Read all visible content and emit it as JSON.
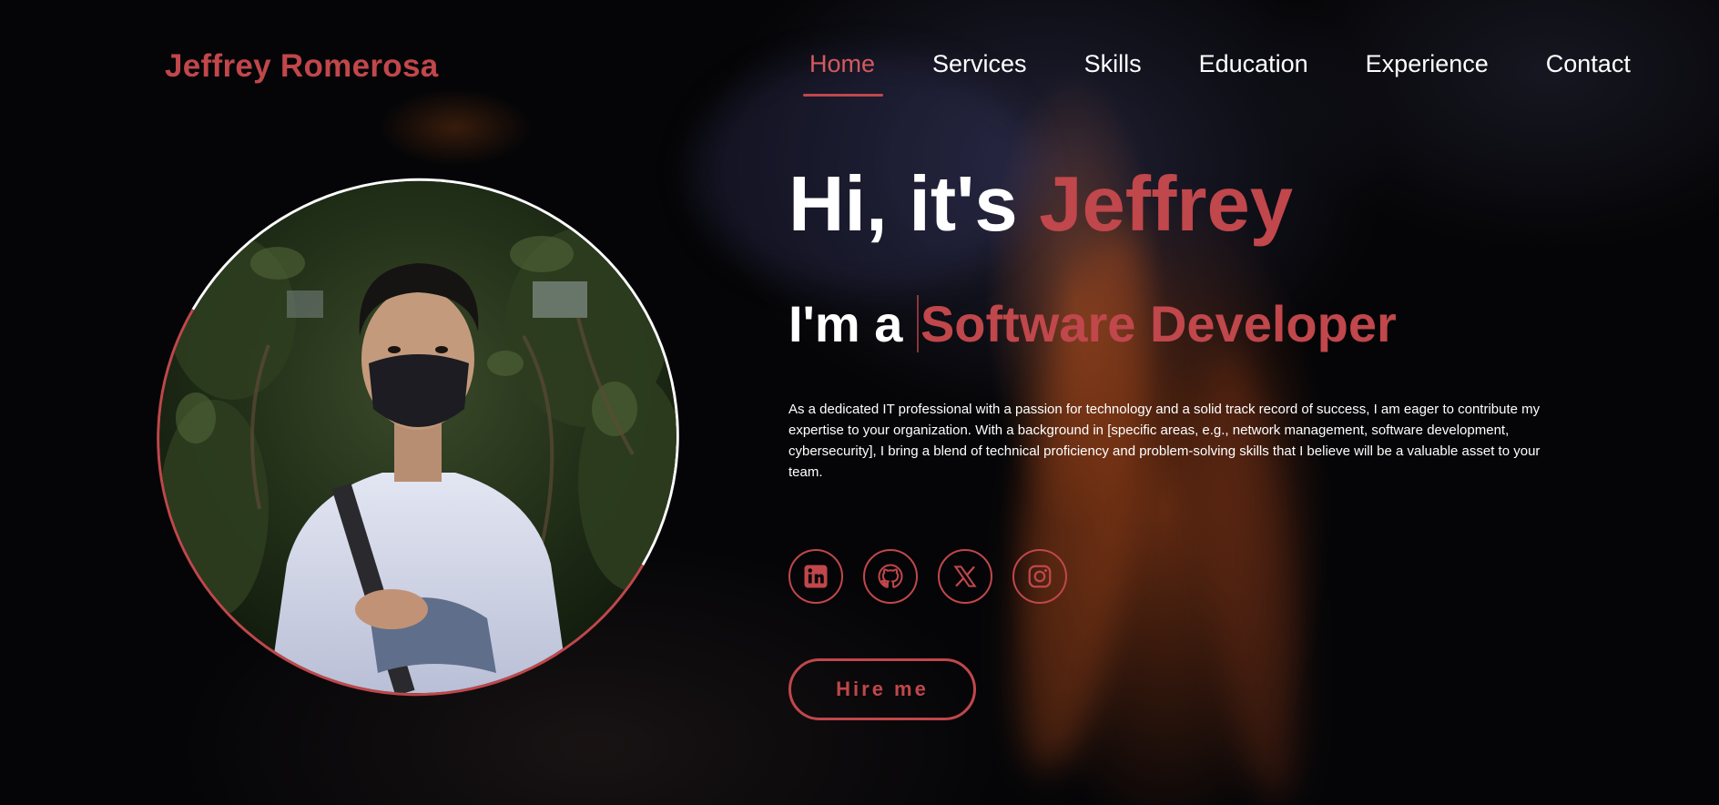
{
  "header": {
    "logo": "Jeffrey Romerosa",
    "nav": [
      {
        "label": "Home",
        "active": true
      },
      {
        "label": "Services"
      },
      {
        "label": "Skills"
      },
      {
        "label": "Education"
      },
      {
        "label": "Experience"
      },
      {
        "label": "Contact"
      }
    ]
  },
  "hero": {
    "greeting": "Hi, it's ",
    "name": "Jeffrey",
    "role_prefix": "I'm a ",
    "role": "Software Developer",
    "description": "As a dedicated IT professional with a passion for technology and a solid track record of success, I am eager to contribute my expertise to your organization. With a background in [specific areas, e.g., network management, software development, cybersecurity], I bring a blend of technical proficiency and problem-solving skills that I believe will be a valuable asset to your team.",
    "hire_button": "Hire me"
  },
  "socials": [
    {
      "name": "linkedin-icon"
    },
    {
      "name": "github-icon"
    },
    {
      "name": "x-twitter-icon"
    },
    {
      "name": "instagram-icon"
    }
  ],
  "colors": {
    "accent": "#c0474b",
    "text": "#ffffff",
    "background": "#050507"
  }
}
